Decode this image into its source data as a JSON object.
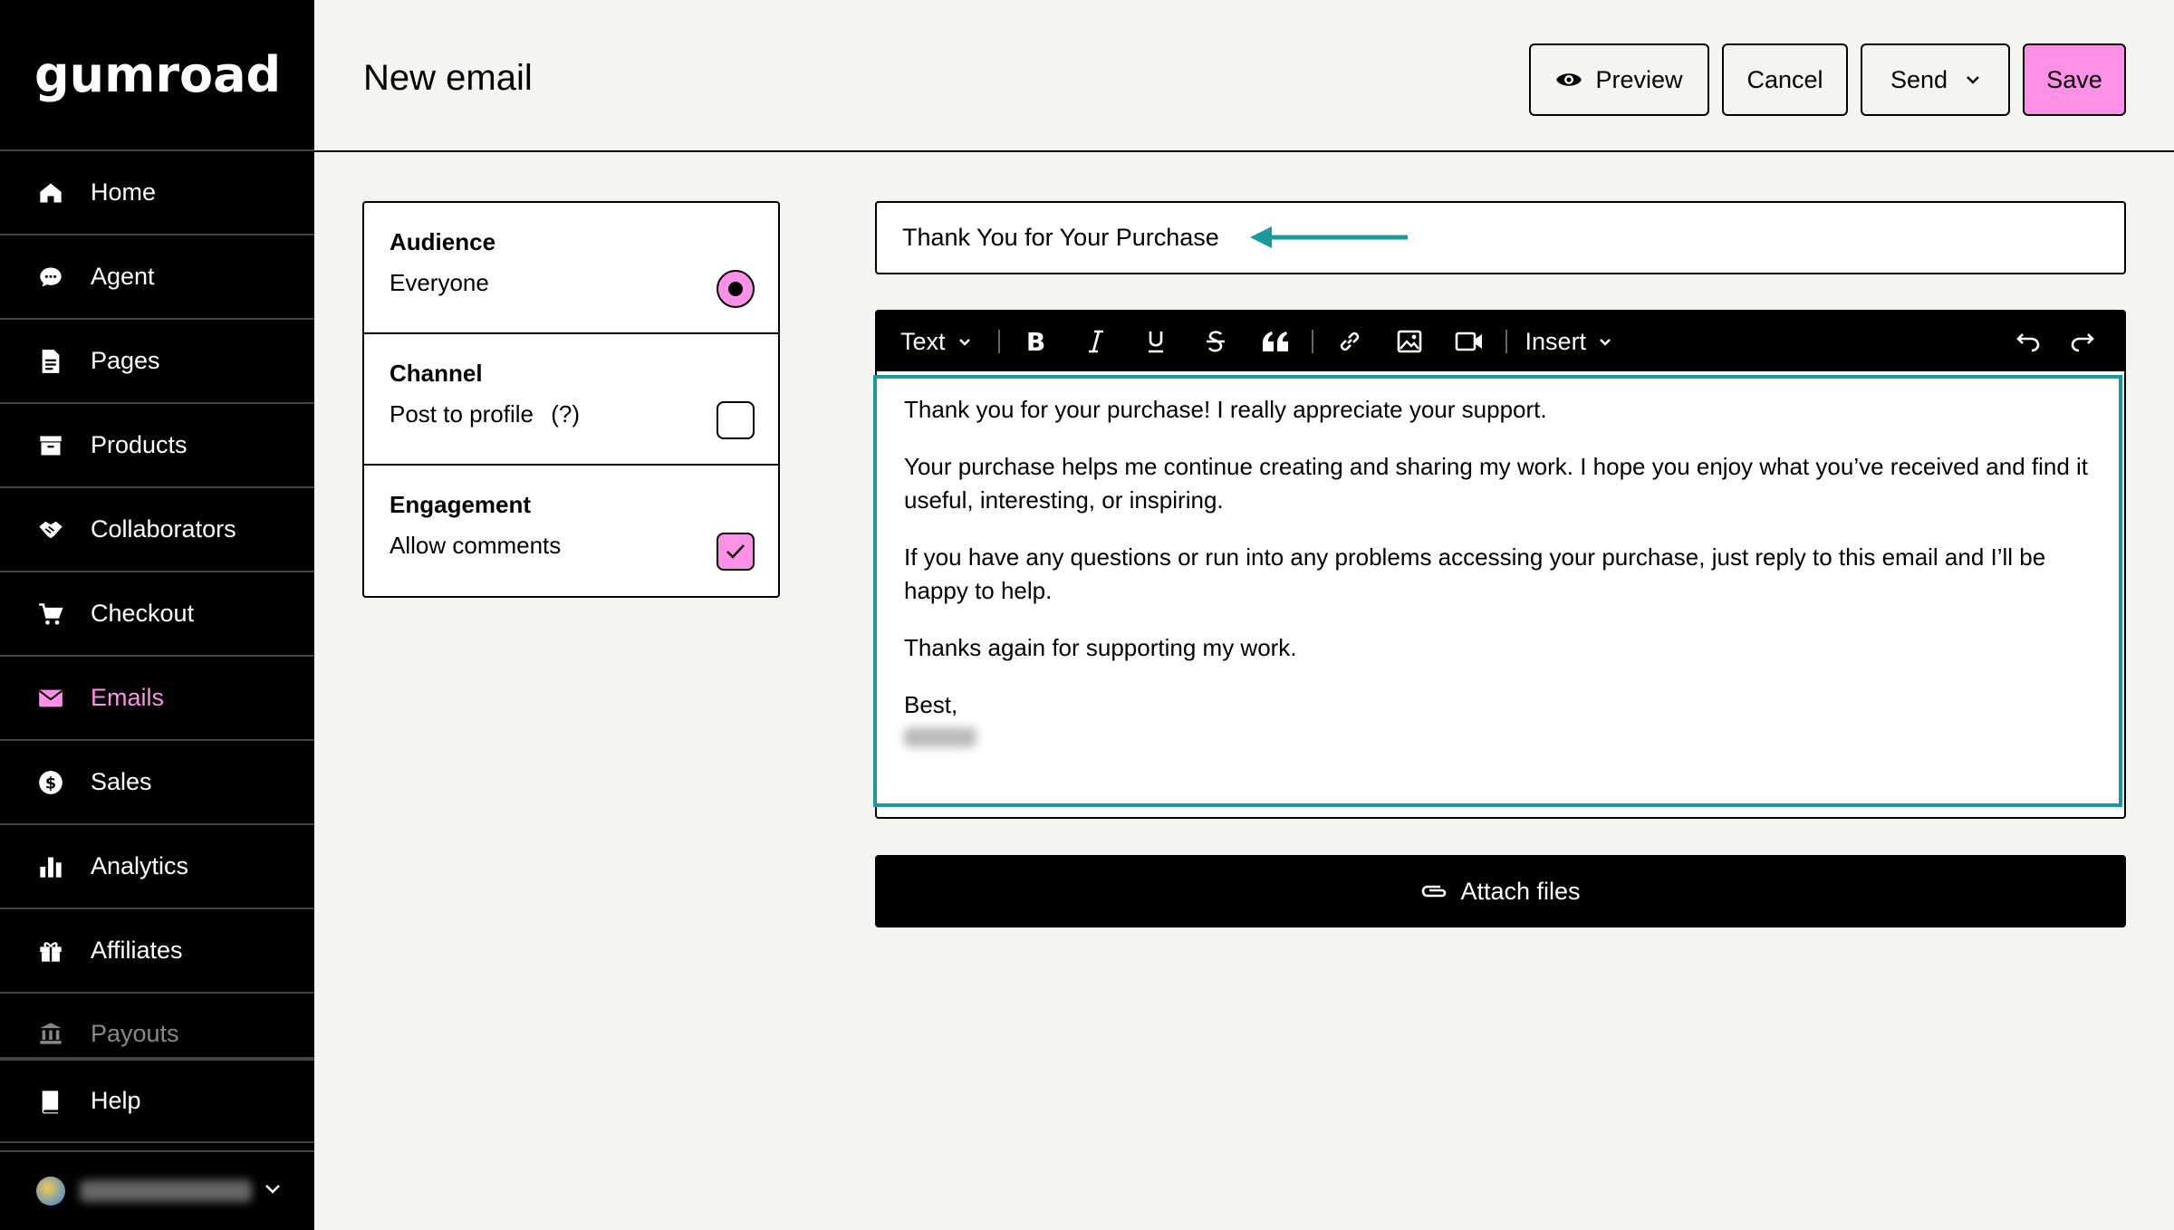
{
  "sidebar": {
    "logo": "GUMROAD",
    "items": [
      {
        "label": "Home",
        "icon": "home-icon"
      },
      {
        "label": "Agent",
        "icon": "chat-bubble-icon"
      },
      {
        "label": "Pages",
        "icon": "document-icon"
      },
      {
        "label": "Products",
        "icon": "archive-box-icon"
      },
      {
        "label": "Collaborators",
        "icon": "handshake-icon"
      },
      {
        "label": "Checkout",
        "icon": "cart-icon"
      },
      {
        "label": "Emails",
        "icon": "envelope-icon"
      },
      {
        "label": "Sales",
        "icon": "dollar-circle-icon"
      },
      {
        "label": "Analytics",
        "icon": "bar-chart-icon"
      },
      {
        "label": "Affiliates",
        "icon": "gift-icon"
      },
      {
        "label": "Payouts",
        "icon": "bank-icon"
      }
    ],
    "help": {
      "label": "Help",
      "icon": "book-icon"
    },
    "active_item": "Emails",
    "active_color": "#ff90e8"
  },
  "header": {
    "title": "New email",
    "preview_label": "Preview",
    "cancel_label": "Cancel",
    "send_label": "Send",
    "save_label": "Save",
    "save_color": "#ff90e8"
  },
  "settings": {
    "audience": {
      "heading": "Audience",
      "value": "Everyone",
      "selected": true
    },
    "channel": {
      "heading": "Channel",
      "value": "Post to profile",
      "help": "(?)",
      "checked": false
    },
    "engagement": {
      "heading": "Engagement",
      "value": "Allow comments",
      "checked": true
    }
  },
  "subject": {
    "value": "Thank You for Your Purchase"
  },
  "toolbar": {
    "text_style": "Text",
    "insert_label": "Insert",
    "buttons": [
      "bold-icon",
      "italic-icon",
      "underline-icon",
      "strikethrough-icon",
      "quote-icon",
      "link-icon",
      "image-icon",
      "video-icon",
      "undo-icon",
      "redo-icon"
    ]
  },
  "body": {
    "p1": "Thank you for your purchase! I really appreciate your support.",
    "p2": "Your purchase helps me continue creating and sharing my work. I hope you enjoy what you’ve received and find it useful, interesting, or inspiring.",
    "p3": "If you have any questions or run into any problems accessing your purchase, just reply to this email and I’ll be happy to help.",
    "p4": "Thanks again for supporting my work.",
    "closing": "Best,",
    "highlight_color": "#1a9a9c"
  },
  "attach": {
    "label": "Attach files"
  }
}
